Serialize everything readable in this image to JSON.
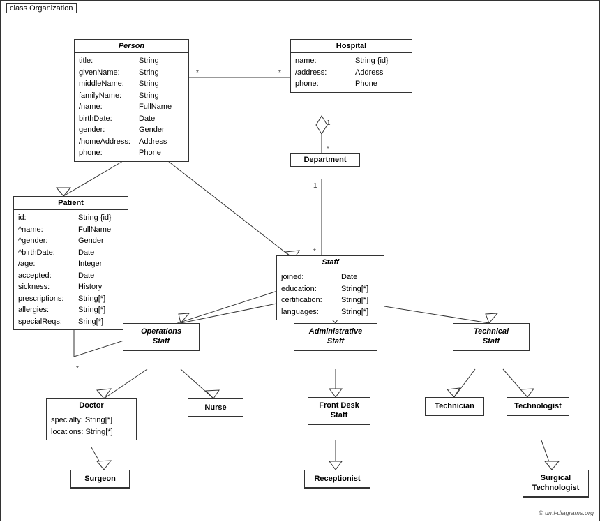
{
  "diagram": {
    "title": "class Organization",
    "classes": {
      "person": {
        "name": "Person",
        "italic": true,
        "attrs": [
          {
            "name": "title:",
            "type": "String"
          },
          {
            "name": "givenName:",
            "type": "String"
          },
          {
            "name": "middleName:",
            "type": "String"
          },
          {
            "name": "familyName:",
            "type": "String"
          },
          {
            "name": "/name:",
            "type": "FullName"
          },
          {
            "name": "birthDate:",
            "type": "Date"
          },
          {
            "name": "gender:",
            "type": "Gender"
          },
          {
            "name": "/homeAddress:",
            "type": "Address"
          },
          {
            "name": "phone:",
            "type": "Phone"
          }
        ]
      },
      "hospital": {
        "name": "Hospital",
        "italic": false,
        "attrs": [
          {
            "name": "name:",
            "type": "String {id}"
          },
          {
            "name": "/address:",
            "type": "Address"
          },
          {
            "name": "phone:",
            "type": "Phone"
          }
        ]
      },
      "patient": {
        "name": "Patient",
        "italic": false,
        "attrs": [
          {
            "name": "id:",
            "type": "String {id}"
          },
          {
            "name": "^name:",
            "type": "FullName"
          },
          {
            "name": "^gender:",
            "type": "Gender"
          },
          {
            "name": "^birthDate:",
            "type": "Date"
          },
          {
            "name": "/age:",
            "type": "Integer"
          },
          {
            "name": "accepted:",
            "type": "Date"
          },
          {
            "name": "sickness:",
            "type": "History"
          },
          {
            "name": "prescriptions:",
            "type": "String[*]"
          },
          {
            "name": "allergies:",
            "type": "String[*]"
          },
          {
            "name": "specialReqs:",
            "type": "Sring[*]"
          }
        ]
      },
      "department": {
        "name": "Department",
        "italic": false,
        "attrs": []
      },
      "staff": {
        "name": "Staff",
        "italic": true,
        "attrs": [
          {
            "name": "joined:",
            "type": "Date"
          },
          {
            "name": "education:",
            "type": "String[*]"
          },
          {
            "name": "certification:",
            "type": "String[*]"
          },
          {
            "name": "languages:",
            "type": "String[*]"
          }
        ]
      },
      "operations_staff": {
        "name": "Operations Staff",
        "italic": true
      },
      "administrative_staff": {
        "name": "Administrative Staff",
        "italic": true
      },
      "technical_staff": {
        "name": "Technical Staff",
        "italic": true
      },
      "doctor": {
        "name": "Doctor",
        "italic": false,
        "attrs": [
          {
            "name": "specialty:",
            "type": "String[*]"
          },
          {
            "name": "locations:",
            "type": "String[*]"
          }
        ]
      },
      "nurse": {
        "name": "Nurse",
        "italic": false
      },
      "front_desk_staff": {
        "name": "Front Desk Staff",
        "italic": false
      },
      "technician": {
        "name": "Technician",
        "italic": false
      },
      "technologist": {
        "name": "Technologist",
        "italic": false
      },
      "surgeon": {
        "name": "Surgeon",
        "italic": false
      },
      "receptionist": {
        "name": "Receptionist",
        "italic": false
      },
      "surgical_technologist": {
        "name": "Surgical Technologist",
        "italic": false
      }
    },
    "copyright": "© uml-diagrams.org"
  }
}
